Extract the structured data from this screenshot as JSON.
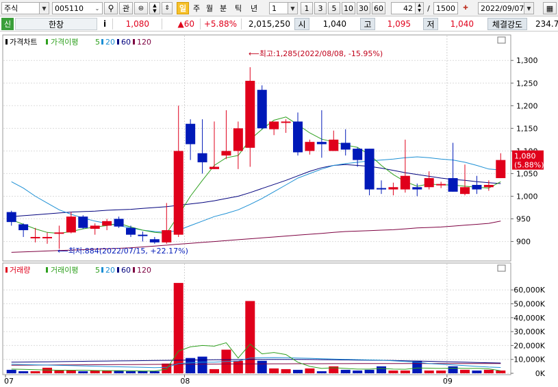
{
  "toolbar": {
    "market_type": "주식",
    "stock_code": "005110",
    "related_label": "관",
    "highlight_label": "일",
    "periods": [
      "주",
      "월",
      "분",
      "틱",
      "년"
    ],
    "interval_value": "1",
    "quick_periods": [
      "1",
      "3",
      "5",
      "10",
      "30",
      "60"
    ],
    "count_value": "42",
    "separator": "/",
    "total_count": "1500",
    "date_value": "2022/09/07"
  },
  "quote": {
    "badge": "신",
    "name": "한창",
    "info_label": "i",
    "price": "1,080",
    "change": "▲60",
    "change_pct": "+5.88%",
    "volume": "2,015,250",
    "open_label": "시",
    "open": "1,040",
    "high_label": "고",
    "high": "1,095",
    "low_label": "저",
    "low": "1,040",
    "strength_label": "체결강도",
    "strength": "234.7"
  },
  "colors": {
    "up": "#e0001b",
    "down": "#0019b8",
    "ma5": "#2ea01e",
    "ma20": "#1b8fd4",
    "ma60": "#00007d",
    "ma120": "#7d0040"
  },
  "chart_data": [
    {
      "type": "candlestick",
      "legend": [
        "가격차트",
        "가격이평",
        "5",
        "20",
        "60",
        "120"
      ],
      "x_tick_labels": [
        "07",
        "08",
        "09"
      ],
      "ylim": [
        860,
        1320
      ],
      "y_ticks": [
        900,
        950,
        1000,
        1050,
        1100,
        1150,
        1200,
        1250,
        1300
      ],
      "y_tick_labels": [
        "900",
        "950",
        "1,000",
        "1,050",
        "1,100",
        "1,150",
        "1,200",
        "1,250",
        "1,300"
      ],
      "annotation_high": "최고:1,285(2022/08/08, -15.95%)",
      "annotation_low": "최저:884(2022/07/15, +22.17%)",
      "last_price_label": "1,080",
      "last_pct_label": "(5.88%)",
      "candles": [
        {
          "o": 965,
          "h": 968,
          "l": 935,
          "c": 943
        },
        {
          "o": 938,
          "h": 940,
          "l": 910,
          "c": 925
        },
        {
          "o": 910,
          "h": 930,
          "l": 898,
          "c": 910
        },
        {
          "o": 910,
          "h": 920,
          "l": 895,
          "c": 910
        },
        {
          "o": 918,
          "h": 935,
          "l": 884,
          "c": 920
        },
        {
          "o": 920,
          "h": 965,
          "l": 918,
          "c": 955
        },
        {
          "o": 955,
          "h": 958,
          "l": 928,
          "c": 930
        },
        {
          "o": 928,
          "h": 940,
          "l": 915,
          "c": 935
        },
        {
          "o": 935,
          "h": 950,
          "l": 925,
          "c": 945
        },
        {
          "o": 950,
          "h": 955,
          "l": 930,
          "c": 933
        },
        {
          "o": 930,
          "h": 935,
          "l": 910,
          "c": 915
        },
        {
          "o": 915,
          "h": 922,
          "l": 900,
          "c": 912
        },
        {
          "o": 905,
          "h": 910,
          "l": 895,
          "c": 898
        },
        {
          "o": 898,
          "h": 985,
          "l": 895,
          "c": 925
        },
        {
          "o": 915,
          "h": 1200,
          "l": 910,
          "c": 1100
        },
        {
          "o": 1160,
          "h": 1170,
          "l": 1080,
          "c": 1115
        },
        {
          "o": 1095,
          "h": 1170,
          "l": 1050,
          "c": 1075
        },
        {
          "o": 1060,
          "h": 1165,
          "l": 1060,
          "c": 1065
        },
        {
          "o": 1090,
          "h": 1190,
          "l": 1082,
          "c": 1100
        },
        {
          "o": 1100,
          "h": 1165,
          "l": 1060,
          "c": 1150
        },
        {
          "o": 1107,
          "h": 1285,
          "l": 1065,
          "c": 1255
        },
        {
          "o": 1235,
          "h": 1245,
          "l": 1148,
          "c": 1150
        },
        {
          "o": 1148,
          "h": 1165,
          "l": 1135,
          "c": 1165
        },
        {
          "o": 1165,
          "h": 1170,
          "l": 1140,
          "c": 1165
        },
        {
          "o": 1165,
          "h": 1185,
          "l": 1090,
          "c": 1097
        },
        {
          "o": 1100,
          "h": 1125,
          "l": 1092,
          "c": 1120
        },
        {
          "o": 1120,
          "h": 1190,
          "l": 1085,
          "c": 1115
        },
        {
          "o": 1100,
          "h": 1145,
          "l": 1100,
          "c": 1125
        },
        {
          "o": 1118,
          "h": 1148,
          "l": 1090,
          "c": 1103
        },
        {
          "o": 1105,
          "h": 1108,
          "l": 1065,
          "c": 1080
        },
        {
          "o": 1105,
          "h": 1105,
          "l": 1002,
          "c": 1015
        },
        {
          "o": 1018,
          "h": 1035,
          "l": 1005,
          "c": 1015
        },
        {
          "o": 1015,
          "h": 1030,
          "l": 1002,
          "c": 1020
        },
        {
          "o": 1015,
          "h": 1125,
          "l": 1008,
          "c": 1045
        },
        {
          "o": 1020,
          "h": 1028,
          "l": 1000,
          "c": 1015
        },
        {
          "o": 1020,
          "h": 1055,
          "l": 1015,
          "c": 1040
        },
        {
          "o": 1025,
          "h": 1032,
          "l": 1018,
          "c": 1027
        },
        {
          "o": 1040,
          "h": 1118,
          "l": 1010,
          "c": 1010
        },
        {
          "o": 1005,
          "h": 1070,
          "l": 1002,
          "c": 1020
        },
        {
          "o": 1025,
          "h": 1045,
          "l": 1005,
          "c": 1015
        },
        {
          "o": 1020,
          "h": 1035,
          "l": 1012,
          "c": 1025
        },
        {
          "o": 1040,
          "h": 1095,
          "l": 1040,
          "c": 1080
        }
      ],
      "ma5": [
        948,
        938,
        928,
        920,
        918,
        922,
        928,
        932,
        935,
        940,
        932,
        925,
        920,
        918,
        958,
        1000,
        1035,
        1068,
        1085,
        1090,
        1125,
        1148,
        1168,
        1175,
        1158,
        1140,
        1126,
        1120,
        1113,
        1108,
        1092,
        1068,
        1048,
        1032,
        1022,
        1027,
        1025,
        1025,
        1022,
        1020,
        1018,
        1032
      ],
      "ma20": [
        1032,
        1018,
        1000,
        985,
        970,
        960,
        952,
        945,
        940,
        935,
        930,
        925,
        922,
        920,
        925,
        935,
        945,
        955,
        962,
        970,
        982,
        995,
        1010,
        1025,
        1040,
        1050,
        1060,
        1068,
        1072,
        1075,
        1078,
        1080,
        1082,
        1085,
        1087,
        1085,
        1082,
        1080,
        1075,
        1068,
        1060,
        1058
      ],
      "ma60": [
        955,
        957,
        959,
        961,
        963,
        965,
        966,
        967,
        969,
        970,
        971,
        973,
        975,
        977,
        980,
        983,
        986,
        990,
        995,
        1000,
        1008,
        1017,
        1026,
        1035,
        1045,
        1055,
        1063,
        1068,
        1070,
        1068,
        1066,
        1062,
        1057,
        1052,
        1048,
        1044,
        1040,
        1037,
        1035,
        1032,
        1030,
        1028
      ],
      "ma120": [
        876,
        877,
        878,
        879,
        880,
        881,
        882,
        883,
        884,
        885,
        886,
        888,
        890,
        892,
        894,
        896,
        898,
        900,
        902,
        904,
        906,
        908,
        910,
        912,
        914,
        916,
        918,
        920,
        922,
        923,
        924,
        925,
        926,
        928,
        930,
        931,
        932,
        934,
        936,
        938,
        940,
        945
      ]
    },
    {
      "type": "bar",
      "legend": [
        "거래량",
        "거래이평",
        "5",
        "20",
        "60",
        "120"
      ],
      "x_tick_labels": [
        "07",
        "08",
        "09"
      ],
      "ylim": [
        0,
        68000
      ],
      "y_ticks": [
        0,
        10000,
        20000,
        30000,
        40000,
        50000,
        60000
      ],
      "y_tick_labels": [
        "0K",
        "10,000K",
        "20,000K",
        "30,000K",
        "40,000K",
        "50,000K",
        "60,000K"
      ],
      "values": [
        2500,
        1500,
        1500,
        4000,
        2000,
        2000,
        1500,
        2000,
        2000,
        2000,
        1500,
        1500,
        1500,
        7000,
        65000,
        11000,
        12000,
        3000,
        17000,
        9000,
        52000,
        9000,
        3500,
        3000,
        2500,
        3500,
        1500,
        5000,
        2500,
        2000,
        2500,
        5000,
        2000,
        2000,
        9000,
        2000,
        2000,
        5000,
        2500,
        2000,
        2500,
        2015
      ],
      "ma5": [
        3000,
        2800,
        2600,
        2300,
        2200,
        2200,
        2200,
        2000,
        1900,
        1900,
        1800,
        1700,
        1700,
        3000,
        16000,
        19000,
        20000,
        19500,
        22000,
        11000,
        21000,
        14000,
        15000,
        13500,
        8000,
        5000,
        3500,
        4000,
        3500,
        3000,
        3000,
        3500,
        3000,
        2900,
        3800,
        3700,
        3500,
        3700,
        3500,
        3500,
        3200,
        1800
      ],
      "ma20": [
        6500,
        6300,
        6100,
        5900,
        5700,
        5500,
        5300,
        5100,
        4900,
        4700,
        4500,
        4300,
        4100,
        4300,
        7000,
        7500,
        8000,
        8000,
        8500,
        8800,
        11000,
        11200,
        11300,
        11200,
        11000,
        10800,
        10500,
        10200,
        10000,
        9800,
        9600,
        9400,
        9000,
        8500,
        8000,
        7000,
        6500,
        6000,
        5500,
        5000,
        4500,
        4200
      ],
      "ma60": [
        8000,
        8100,
        8200,
        8300,
        8400,
        8500,
        8600,
        8700,
        8800,
        8900,
        9000,
        9100,
        9200,
        9300,
        9400,
        9500,
        9600,
        9700,
        9800,
        9900,
        10000,
        10000,
        10000,
        10000,
        10000,
        9900,
        9800,
        9700,
        9600,
        9500,
        9400,
        9300,
        9200,
        9000,
        8800,
        8600,
        8400,
        8200,
        8000,
        7800,
        7600,
        7400
      ],
      "ma120": [
        5800,
        5850,
        5900,
        5950,
        6000,
        6050,
        6100,
        6150,
        6200,
        6250,
        6300,
        6350,
        6400,
        6450,
        6500,
        6550,
        6600,
        6650,
        6700,
        6750,
        6800,
        6820,
        6840,
        6860,
        6880,
        6900,
        6920,
        6940,
        6960,
        6980,
        7000,
        7000,
        7000,
        7000,
        7000,
        7000,
        7000,
        7000,
        7000,
        7000,
        7000,
        7000
      ]
    }
  ]
}
